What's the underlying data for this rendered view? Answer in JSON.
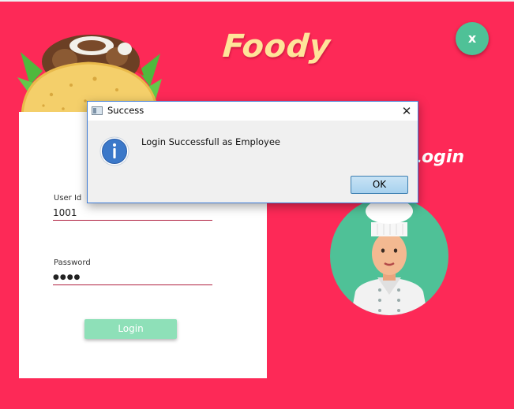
{
  "app": {
    "brand_title": "Foody",
    "close_label": "x",
    "side_title": "Login"
  },
  "login_form": {
    "user_id_label": "User Id",
    "user_id_value": "1001",
    "password_label": "Password",
    "password_value": "●●●●",
    "login_button": "Login"
  },
  "dialog": {
    "title": "Success",
    "close_glyph": "✕",
    "message": "Login Successfull as Employee",
    "ok_label": "OK",
    "icon": "info-icon"
  },
  "colors": {
    "background": "#fd2957",
    "brand_text": "#ffe49a",
    "accent_green": "#4fc197",
    "login_button": "#8ee0b8",
    "dialog_border": "#3d7bd6"
  }
}
